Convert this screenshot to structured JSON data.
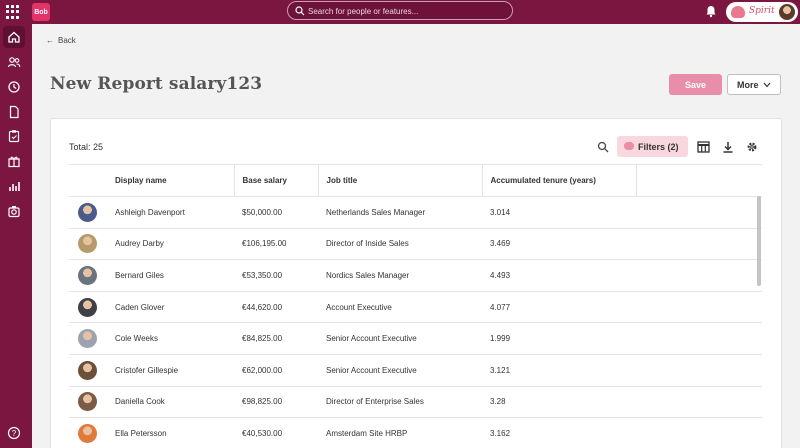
{
  "topbar": {
    "logo_text": "Bob",
    "search_placeholder": "Search for people or features...",
    "company_name": "Spirit"
  },
  "icons": {
    "apps": "apps-grid-icon",
    "bell": "bell-icon",
    "sidebar": [
      "home-icon",
      "people-icon",
      "clock-icon",
      "document-icon",
      "clipboard-icon",
      "gift-icon",
      "chart-icon",
      "camera-icon"
    ],
    "help": "help-icon"
  },
  "page": {
    "back_label": "Back",
    "title": "New Report salary123",
    "save_label": "Save",
    "more_label": "More"
  },
  "report": {
    "total_label": "Total: 25",
    "filters_label": "Filters (2)",
    "columns": [
      "Display name",
      "Base salary",
      "Job title",
      "Accumulated tenure (years)"
    ],
    "rows": [
      {
        "name": "Ashleigh Davenport",
        "salary": "$50,000.00",
        "title": "Netherlands Sales Manager",
        "tenure": "3.014",
        "avatar_color": "#4a5a8a"
      },
      {
        "name": "Audrey Darby",
        "salary": "€106,195.00",
        "title": "Director of Inside Sales",
        "tenure": "3.469",
        "avatar_color": "#b59a6a"
      },
      {
        "name": "Bernard Giles",
        "salary": "€53,350.00",
        "title": "Nordics Sales Manager",
        "tenure": "4.493",
        "avatar_color": "#6b7280"
      },
      {
        "name": "Caden Glover",
        "salary": "€44,620.00",
        "title": "Account Executive",
        "tenure": "4.077",
        "avatar_color": "#3f3f46"
      },
      {
        "name": "Cole Weeks",
        "salary": "€84,825.00",
        "title": "Senior Account Executive",
        "tenure": "1.999",
        "avatar_color": "#9ca3af"
      },
      {
        "name": "Cristofer Gillespie",
        "salary": "€62,000.00",
        "title": "Senior Account Executive",
        "tenure": "3.121",
        "avatar_color": "#6b4f3a"
      },
      {
        "name": "Daniella Cook",
        "salary": "€98,825.00",
        "title": "Director of Enterprise Sales",
        "tenure": "3.28",
        "avatar_color": "#7c5a44"
      },
      {
        "name": "Ella Petersson",
        "salary": "€40,530.00",
        "title": "Amsterdam Site HRBP",
        "tenure": "3.162",
        "avatar_color": "#e07a3a"
      }
    ]
  },
  "colors": {
    "brand": "#7a1640",
    "save": "#e88eab",
    "filters_bg": "#f9d7df"
  }
}
